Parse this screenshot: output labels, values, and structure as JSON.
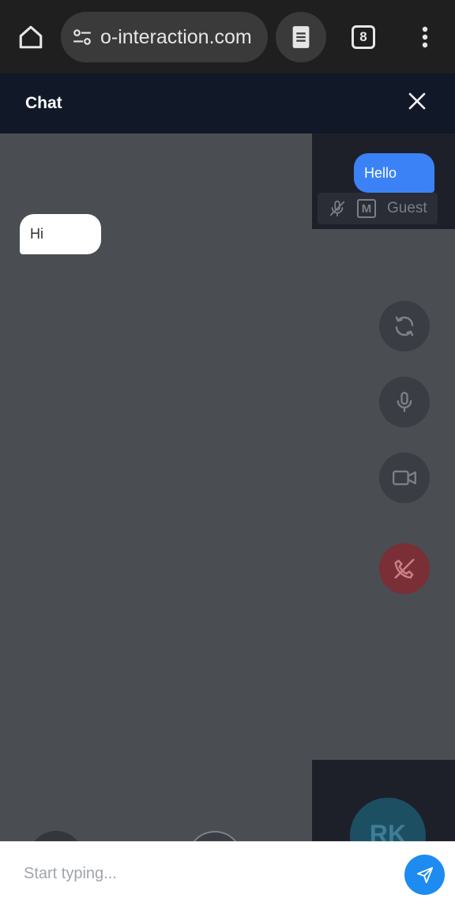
{
  "browser": {
    "url": "o-interaction.com",
    "tab_count": "8"
  },
  "chat": {
    "title": "Chat",
    "messages": [
      {
        "text": "Hello",
        "sender": "self"
      },
      {
        "text": "Hi",
        "sender": "other"
      }
    ]
  },
  "local_participant": {
    "badge": "M",
    "name": "Guest"
  },
  "remote_participant": {
    "initials": "RK"
  },
  "controls": {
    "icons": [
      "refresh-icon",
      "microphone-icon",
      "video-camera-icon",
      "end-call-icon"
    ]
  },
  "composer": {
    "placeholder": "Start typing..."
  },
  "colors": {
    "accent": "#3b82f6",
    "send": "#1d8bf0",
    "header": "#111827",
    "end_call": "#7a2e36"
  }
}
